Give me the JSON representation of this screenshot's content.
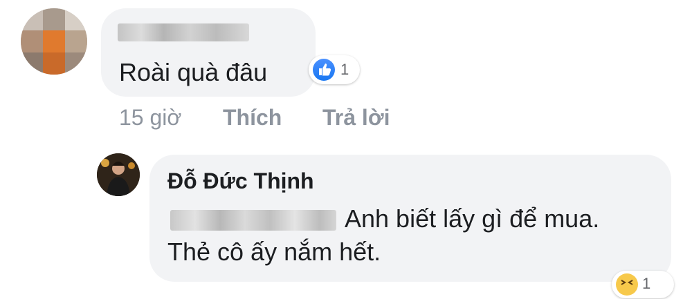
{
  "comment1": {
    "text": "Roài quà đâu",
    "reaction_count": "1",
    "reaction_icon": "like-icon",
    "time": "15 giờ",
    "like_label": "Thích",
    "reply_label": "Trả lời"
  },
  "comment2": {
    "author": "Đỗ Đức Thịnh",
    "line1": "Anh biết lấy gì để mua.",
    "line2": "Thẻ cô ấy nắm hết.",
    "reaction_count": "1",
    "reaction_icon": "haha-icon"
  },
  "colors": {
    "bubble": "#f2f3f5",
    "action_text": "#8d949e",
    "like_blue": "#1877f2"
  }
}
